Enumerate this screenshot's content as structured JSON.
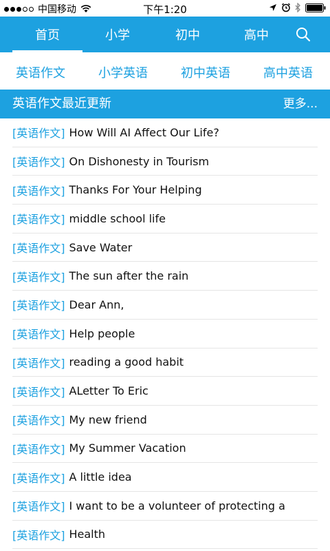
{
  "status_bar": {
    "carrier": "中国移动",
    "time": "下午1:20"
  },
  "nav": {
    "tabs": [
      {
        "label": "首页",
        "active": true
      },
      {
        "label": "小学",
        "active": false
      },
      {
        "label": "初中",
        "active": false
      },
      {
        "label": "高中",
        "active": false
      }
    ],
    "search_icon": "search-icon"
  },
  "sub_nav": {
    "items": [
      {
        "label": "英语作文"
      },
      {
        "label": "小学英语"
      },
      {
        "label": "初中英语"
      },
      {
        "label": "高中英语"
      }
    ]
  },
  "section": {
    "title": "英语作文最近更新",
    "more": "更多..."
  },
  "articles": [
    {
      "tag": "[英语作文]",
      "title": "How Will AI Affect Our Life?"
    },
    {
      "tag": "[英语作文]",
      "title": "On Dishonesty in Tourism"
    },
    {
      "tag": "[英语作文]",
      "title": "Thanks For Your Helping"
    },
    {
      "tag": "[英语作文]",
      "title": "middle school life"
    },
    {
      "tag": "[英语作文]",
      "title": "Save Water"
    },
    {
      "tag": "[英语作文]",
      "title": "The sun after the rain"
    },
    {
      "tag": "[英语作文]",
      "title": "Dear Ann,"
    },
    {
      "tag": "[英语作文]",
      "title": "Help people"
    },
    {
      "tag": "[英语作文]",
      "title": "reading a good habit"
    },
    {
      "tag": "[英语作文]",
      "title": "ALetter To Eric"
    },
    {
      "tag": "[英语作文]",
      "title": "My new friend"
    },
    {
      "tag": "[英语作文]",
      "title": "My Summer Vacation"
    },
    {
      "tag": "[英语作文]",
      "title": "A little idea"
    },
    {
      "tag": "[英语作文]",
      "title": "I want to be a volunteer of protecting a"
    },
    {
      "tag": "[英语作文]",
      "title": "Health"
    }
  ],
  "colors": {
    "accent": "#1da1e0",
    "text": "#111111",
    "divider": "#e5e5e5"
  }
}
